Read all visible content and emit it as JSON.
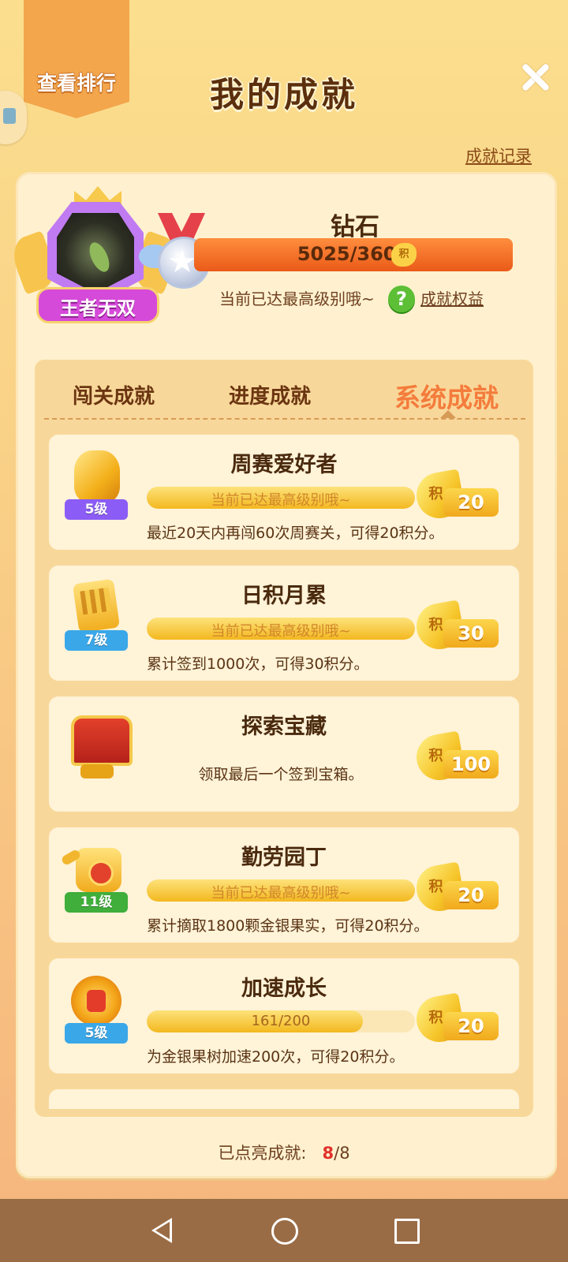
{
  "header": {
    "rank_tab_label": "查看排行",
    "title": "我的成就",
    "record_link": "成就记录"
  },
  "profile": {
    "badge_label": "王者无双",
    "level_name": "钻石",
    "score_text": "5025/3600",
    "score_unit_icon": "积",
    "status_text": "当前已达最高级别哦~",
    "help_icon": "?",
    "benefit_link": "成就权益"
  },
  "tabs": [
    {
      "label": "闯关成就",
      "active": false
    },
    {
      "label": "进度成就",
      "active": false
    },
    {
      "label": "系统成就",
      "active": true
    }
  ],
  "achievements": [
    {
      "title": "周赛爱好者",
      "level": "5级",
      "bar_text": "当前已达最高级别哦~",
      "progress": 1.0,
      "reward": "20",
      "desc": "最近20天内再闯60次周赛关，可得20积分。"
    },
    {
      "title": "日积月累",
      "level": "7级",
      "bar_text": "当前已达最高级别哦~",
      "progress": 1.0,
      "reward": "30",
      "desc": "累计签到1000次，可得30积分。"
    },
    {
      "title": "探索宝藏",
      "level": "",
      "bar_text": "",
      "progress": null,
      "reward": "100",
      "desc": "领取最后一个签到宝箱。"
    },
    {
      "title": "勤劳园丁",
      "level": "11级",
      "bar_text": "当前已达最高级别哦~",
      "progress": 1.0,
      "reward": "20",
      "desc": "累计摘取1800颗金银果实，可得20积分。"
    },
    {
      "title": "加速成长",
      "level": "5级",
      "bar_text": "161/200",
      "progress": 0.805,
      "reward": "20",
      "desc": "为金银果树加速200次，可得20积分。"
    },
    {
      "title": "",
      "level": "",
      "bar_text": "",
      "progress": null,
      "reward": "",
      "desc": ""
    }
  ],
  "reward_icon": "积",
  "footer": {
    "label": "已点亮成就:",
    "lit": "8",
    "total": "/8"
  },
  "colors": {
    "accent_orange": "#f47c3c",
    "ribbon_purple": "#8b5cf6",
    "ribbon_blue": "#3aa7e8",
    "ribbon_green": "#3fae3a"
  },
  "icons": [
    "close-icon",
    "help-icon",
    "nav-back-icon",
    "nav-home-icon",
    "nav-recent-icon"
  ]
}
